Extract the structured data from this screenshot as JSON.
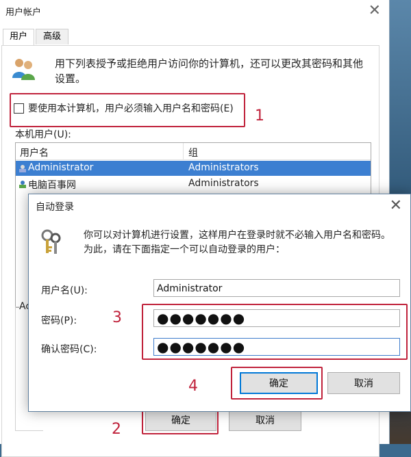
{
  "main_window": {
    "title": "用户帐户",
    "tabs": [
      {
        "label": "用户"
      },
      {
        "label": "高级"
      }
    ],
    "description": "用下列表授予或拒绝用户访问你的计算机，还可以更改其密码和其他设置。",
    "require_login_label": "要使用本计算机，用户必须输入用户名和密码(E)",
    "require_login_checked": false,
    "local_users_label": "本机用户(U):",
    "columns": [
      "用户名",
      "组"
    ],
    "users": [
      {
        "name": "Administrator",
        "group": "Administrators",
        "selected": true
      },
      {
        "name": "电脑百事网",
        "group": "Administrators",
        "selected": false
      }
    ],
    "groupbox_fragment": "Ac",
    "ok_label": "确定",
    "cancel_label": "取消"
  },
  "auto_login_dialog": {
    "title": "自动登录",
    "description": "你可以对计算机进行设置，这样用户在登录时就不必输入用户名和密码。为此，请在下面指定一个可以自动登录的用户：",
    "username_label": "用户名(U):",
    "username_value": "Administrator",
    "password_label": "密码(P):",
    "password_value": "●●●●●●●",
    "confirm_label": "确认密码(C):",
    "confirm_value": "●●●●●●●",
    "ok_label": "确定",
    "cancel_label": "取消"
  },
  "annotations": [
    "1",
    "2",
    "3",
    "4"
  ],
  "colors": {
    "annotation": "#c0223b",
    "selection": "#3c7fd1",
    "focus": "#0078d7"
  }
}
